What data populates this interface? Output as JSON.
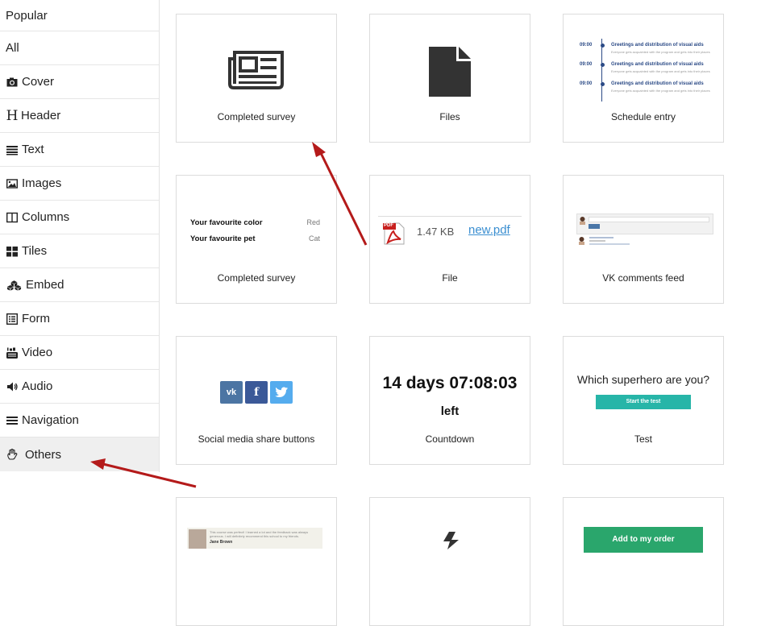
{
  "sidebar": {
    "items": [
      {
        "label": "Popular",
        "icon": ""
      },
      {
        "label": "All",
        "icon": ""
      },
      {
        "label": "Cover",
        "icon": "camera-icon"
      },
      {
        "label": "Header",
        "icon": "heading-icon"
      },
      {
        "label": "Text",
        "icon": "text-lines-icon"
      },
      {
        "label": "Images",
        "icon": "image-icon"
      },
      {
        "label": "Columns",
        "icon": "columns-icon"
      },
      {
        "label": "Tiles",
        "icon": "tiles-icon"
      },
      {
        "label": "Embed",
        "icon": "cubes-icon"
      },
      {
        "label": "Form",
        "icon": "form-icon"
      },
      {
        "label": "Video",
        "icon": "youtube-icon"
      },
      {
        "label": "Audio",
        "icon": "speaker-icon"
      },
      {
        "label": "Navigation",
        "icon": "hamburger-icon"
      },
      {
        "label": "Others",
        "icon": "hand-icon"
      }
    ],
    "header_glyph": "H"
  },
  "cards": [
    {
      "label": "Completed survey",
      "preview": "newspaper-icon"
    },
    {
      "label": "Files",
      "preview": "file-icon"
    },
    {
      "label": "Schedule entry",
      "preview": "schedule"
    },
    {
      "label": "Completed survey",
      "preview": "survey"
    },
    {
      "label": "File",
      "preview": "pdf-file"
    },
    {
      "label": "VK comments feed",
      "preview": "comments"
    },
    {
      "label": "Social media share buttons",
      "preview": "share-buttons"
    },
    {
      "label": "Countdown",
      "preview": "countdown"
    },
    {
      "label": "Test",
      "preview": "test"
    }
  ],
  "schedule": {
    "rows": [
      {
        "time": "09:00",
        "title": "Greetings and distribution of visual aids",
        "sub": "Everyone gets acquainted with the program and gets into their places"
      },
      {
        "time": "09:00",
        "title": "Greetings and distribution of visual aids",
        "sub": "Everyone gets acquainted with the program and gets into their places"
      },
      {
        "time": "09:00",
        "title": "Greetings and distribution of visual aids",
        "sub": "Everyone gets acquainted with the program and gets into their places"
      }
    ]
  },
  "survey": {
    "rows": [
      {
        "q": "Your favourite color",
        "a": "Red"
      },
      {
        "q": "Your favourite pet",
        "a": "Cat"
      }
    ]
  },
  "pdf": {
    "size": "1.47 KB",
    "name": "new.pdf",
    "badge": "PDF"
  },
  "share": {
    "vk": "vk",
    "fb": "f",
    "tw": "t"
  },
  "countdown": {
    "main": "14 days 07:08:03",
    "sub": "left"
  },
  "test": {
    "question": "Which superhero are you?",
    "button": "Start the test"
  },
  "review": {
    "text": "This course was perfect! I learned a lot and the feedback was always generous. I will definitely recommend this school to my friends.",
    "author": "Jane Brown"
  },
  "order": {
    "button": "Add to my order"
  },
  "colors": {
    "arrow": "#b41a1a",
    "link": "#3b8fd1",
    "teal": "#27b5a8",
    "green": "#2aa66c",
    "schedule": "#2b4a86"
  }
}
